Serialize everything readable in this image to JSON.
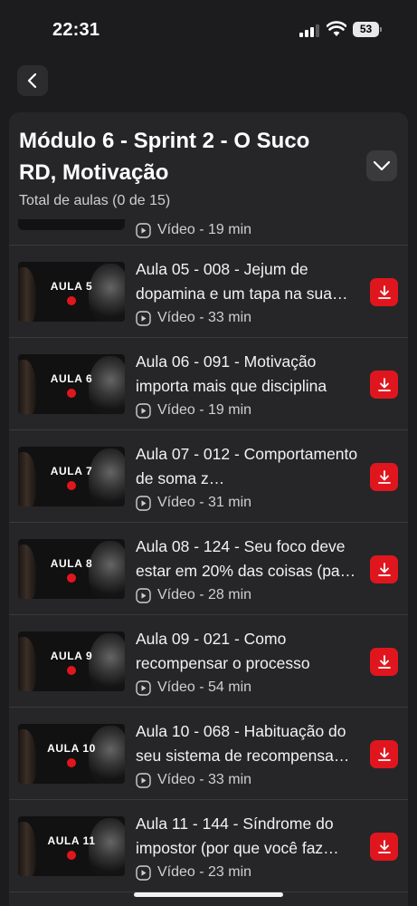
{
  "status_bar": {
    "time": "22:31",
    "battery": "53"
  },
  "module": {
    "title": "Módulo 6 - Sprint 2 - O Suco RD, Motivação",
    "subtitle": "Total de aulas (0 de 15)"
  },
  "partial_lesson": {
    "meta": "Vídeo - 19 min"
  },
  "lessons": [
    {
      "thumb": "AULA 5",
      "title": "Aula 05 - 008 - Jejum de dopamina e um tapa na sua…",
      "meta": "Vídeo - 33 min"
    },
    {
      "thumb": "AULA 6",
      "title": "Aula 06 - 091 - Motivação importa mais que disciplina",
      "meta": "Vídeo - 19 min"
    },
    {
      "thumb": "AULA 7",
      "title": "Aula 07 - 012 - Comportamento de soma z…",
      "meta": "Vídeo - 31 min"
    },
    {
      "thumb": "AULA 8",
      "title": "Aula 08 - 124 - Seu foco deve estar em 20% das coisas (pa…",
      "meta": "Vídeo - 28 min"
    },
    {
      "thumb": "AULA 9",
      "title": "Aula 09 - 021 - Como recompensar o processo",
      "meta": "Vídeo - 54 min"
    },
    {
      "thumb": "AULA 10",
      "title": "Aula 10 - 068 - Habituação do seu sistema de recompensa…",
      "meta": "Vídeo - 33 min"
    },
    {
      "thumb": "AULA 11",
      "title": "Aula 11 - 144 - Síndrome do impostor (por que você faz…",
      "meta": "Vídeo - 23 min"
    }
  ],
  "icons": {
    "back": "chevron-left-icon",
    "collapse": "chevron-down-icon",
    "play": "play-circle-icon",
    "download": "download-icon"
  },
  "colors": {
    "accent": "#e0161e",
    "background": "#1c1c1e",
    "card": "#262628"
  }
}
